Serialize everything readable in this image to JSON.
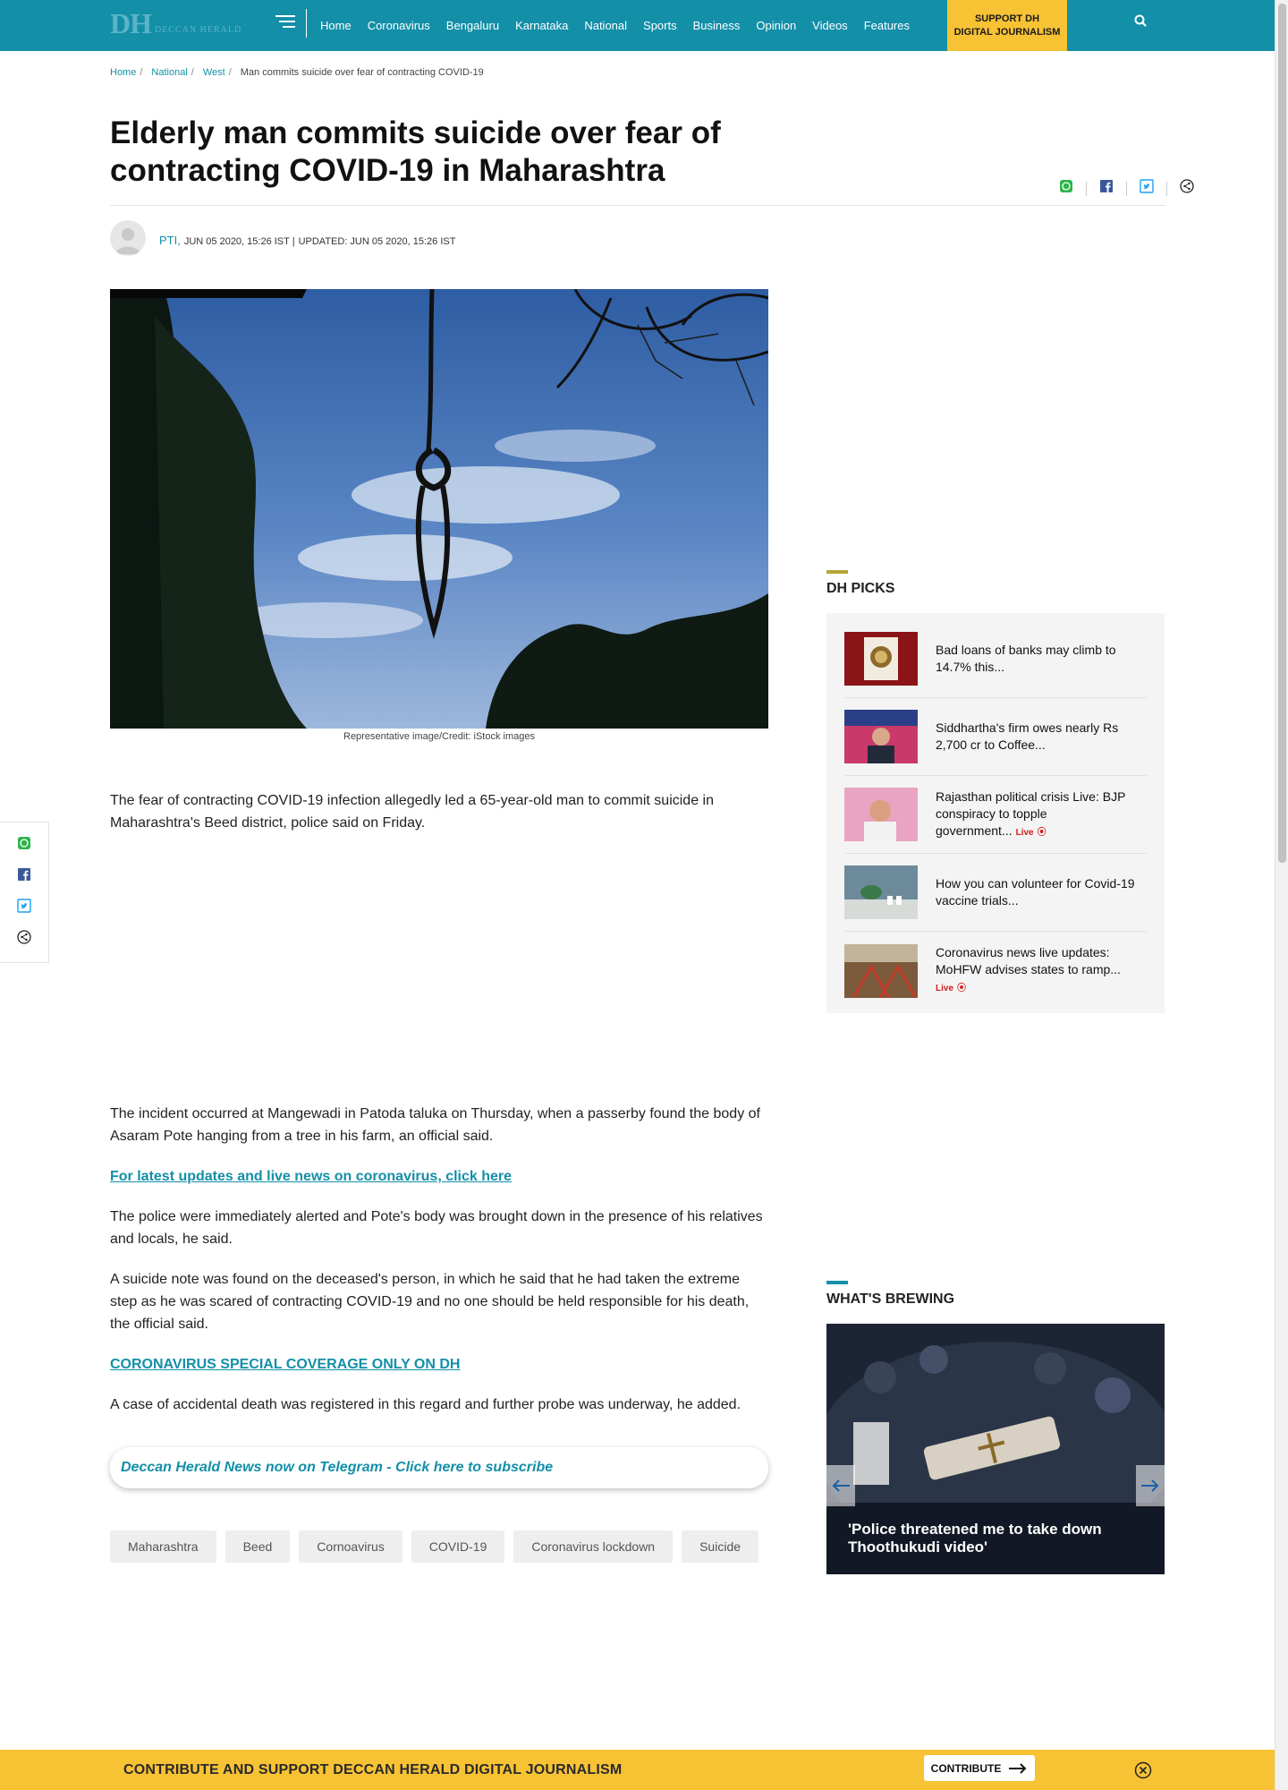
{
  "header": {
    "logo_mark": "DH",
    "logo_name": "DECCAN HERALD",
    "nav": [
      "Home",
      "Coronavirus",
      "Bengaluru",
      "Karnataka",
      "National",
      "Sports",
      "Business",
      "Opinion",
      "Videos",
      "Features"
    ],
    "support_line1": "SUPPORT DH",
    "support_line2": "DIGITAL JOURNALISM",
    "icons": {
      "menu": "hamburger-icon",
      "search": "search-icon"
    }
  },
  "breadcrumb": {
    "items": [
      "Home",
      "National",
      "West"
    ],
    "current": "Man commits suicide over fear of contracting COVID-19"
  },
  "article": {
    "title": "Elderly man commits suicide over fear of contracting COVID-19 in Maharashtra",
    "author": "PTI,",
    "published": "JUN 05 2020, 15:26 IST |",
    "updated": "UPDATED: JUN 05 2020, 15:26 IST",
    "image_caption": "Representative image/Credit: iStock images",
    "para1": "The fear of contracting COVID-19 infection allegedly led a 65-year-old man to commit suicide in Maharashtra's Beed district, police said on Friday.",
    "para2": "The incident occurred at Mangewadi in Patoda taluka on Thursday, when a passerby found the body of Asaram Pote hanging from a tree in his farm, an official said.",
    "link1": "For latest updates and live news on coronavirus, click here",
    "para3": "The police were immediately alerted and Pote's body was brought down in the presence of his relatives and locals, he said.",
    "para4": "A suicide note was found on the deceased's person, in which he said that he had taken the extreme step as he was scared of contracting COVID-19 and no one should be held responsible for his death, the official said.",
    "link2": "CORONAVIRUS SPECIAL COVERAGE ONLY ON DH",
    "para5": "A case of accidental death was registered in this regard and further probe was underway, he added.",
    "telegram": "Deccan Herald News now on Telegram - Click here to subscribe",
    "tags": [
      "Maharashtra",
      "Beed",
      "Cornoavirus",
      "COVID-19",
      "Coronavirus lockdown",
      "Suicide"
    ]
  },
  "share_icons": [
    "whatsapp-icon",
    "facebook-icon",
    "twitter-icon",
    "share-icon"
  ],
  "sidebar": {
    "picks_heading": "DH PICKS",
    "picks": [
      {
        "title": "Bad loans of banks may climb to 14.7% this...",
        "live": ""
      },
      {
        "title": "Siddhartha's firm owes nearly Rs 2,700 cr to Coffee...",
        "live": ""
      },
      {
        "title": "Rajasthan political crisis Live: BJP conspiracy to topple government...",
        "live": "Live"
      },
      {
        "title": "How you can volunteer for Covid-19 vaccine trials...",
        "live": ""
      },
      {
        "title": "Coronavirus news live updates: MoHFW advises states to ramp...",
        "live": "Live"
      }
    ],
    "brewing_heading": "WHAT'S BREWING",
    "brewing_title": "'Police threatened me to take down Thoothukudi video'"
  },
  "contribute": {
    "text": "CONTRIBUTE AND SUPPORT DECCAN HERALD DIGITAL JOURNALISM",
    "button": "CONTRIBUTE"
  },
  "colors": {
    "brand": "#138fa8",
    "accent_yellow": "#f7c234",
    "live_red": "#d31b1b"
  }
}
